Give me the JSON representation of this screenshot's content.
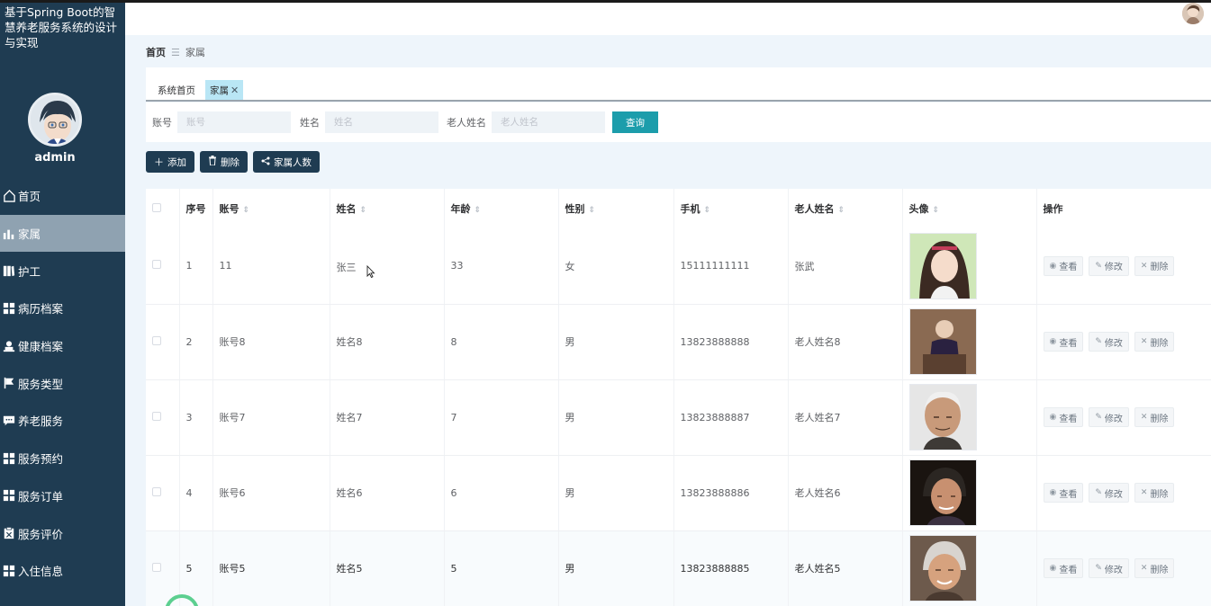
{
  "app": {
    "title": "基于Spring Boot的智慧养老服务系统的设计与实现"
  },
  "sidebar": {
    "user": "admin",
    "items": [
      {
        "label": "首页",
        "icon": "home-icon"
      },
      {
        "label": "家属",
        "icon": "bar-chart-icon",
        "active": true
      },
      {
        "label": "护工",
        "icon": "book-icon"
      },
      {
        "label": "病历档案",
        "icon": "grid-icon"
      },
      {
        "label": "健康档案",
        "icon": "user-stamp-icon"
      },
      {
        "label": "服务类型",
        "icon": "flag-icon"
      },
      {
        "label": "养老服务",
        "icon": "message-icon"
      },
      {
        "label": "服务预约",
        "icon": "grid-icon"
      },
      {
        "label": "服务订单",
        "icon": "grid-icon"
      },
      {
        "label": "服务评价",
        "icon": "clipboard-icon"
      },
      {
        "label": "入住信息",
        "icon": "grid-icon"
      }
    ]
  },
  "breadcrumb": {
    "home": "首页",
    "current": "家属"
  },
  "tabs": [
    {
      "label": "系统首页"
    },
    {
      "label": "家属",
      "closable": true
    }
  ],
  "search": {
    "account_label": "账号",
    "account_placeholder": "账号",
    "name_label": "姓名",
    "name_placeholder": "姓名",
    "elder_label": "老人姓名",
    "elder_placeholder": "老人姓名",
    "button": "查询"
  },
  "actions": {
    "add": "添加",
    "delete": "删除",
    "count": "家属人数"
  },
  "table": {
    "headers": [
      "序号",
      "账号",
      "姓名",
      "年龄",
      "性别",
      "手机",
      "老人姓名",
      "头像",
      "操作"
    ],
    "ops": {
      "view": "查看",
      "edit": "修改",
      "delete": "删除"
    },
    "rows": [
      {
        "idx": "1",
        "account": "11",
        "name": "张三",
        "age": "33",
        "gender": "女",
        "phone": "15111111111",
        "elder": "张武"
      },
      {
        "idx": "2",
        "account": "账号8",
        "name": "姓名8",
        "age": "8",
        "gender": "男",
        "phone": "13823888888",
        "elder": "老人姓名8"
      },
      {
        "idx": "3",
        "account": "账号7",
        "name": "姓名7",
        "age": "7",
        "gender": "男",
        "phone": "13823888887",
        "elder": "老人姓名7"
      },
      {
        "idx": "4",
        "account": "账号6",
        "name": "姓名6",
        "age": "6",
        "gender": "男",
        "phone": "13823888886",
        "elder": "老人姓名6"
      },
      {
        "idx": "5",
        "account": "账号5",
        "name": "姓名5",
        "age": "5",
        "gender": "男",
        "phone": "13823888885",
        "elder": "老人姓名5"
      }
    ]
  }
}
